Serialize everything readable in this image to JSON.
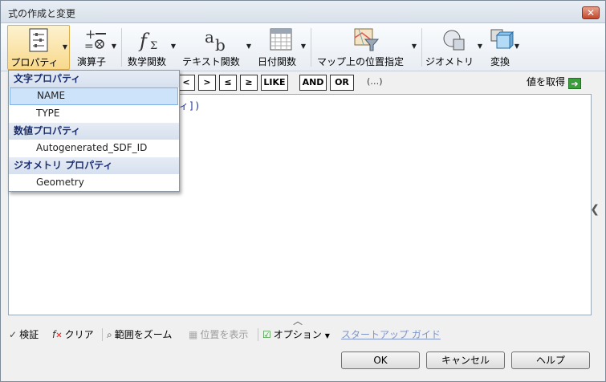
{
  "window": {
    "title": "式の作成と変更",
    "close": "✕"
  },
  "ribbon": {
    "properties": "プロパティ",
    "operators": "演算子",
    "math": "数学関数",
    "text": "テキスト関数",
    "date": "日付関数",
    "location": "マップ上の位置指定",
    "geometry": "ジオメトリ",
    "transform": "変換"
  },
  "operators_row": {
    "buttons": [
      "<",
      ">",
      "≤",
      "≥",
      "LIKE",
      "AND",
      "OR"
    ],
    "more": "(…)",
    "get_value": "値を取得",
    "get_value_icon": "➔"
  },
  "editor": {
    "visible_text": "ィ])"
  },
  "dropdown": {
    "groups": [
      {
        "header": "文字プロパティ",
        "items": [
          "NAME",
          "TYPE"
        ]
      },
      {
        "header": "数値プロパティ",
        "items": [
          "Autogenerated_SDF_ID"
        ]
      },
      {
        "header": "ジオメトリ プロパティ",
        "items": [
          "Geometry"
        ]
      }
    ],
    "selected": "NAME"
  },
  "bottom_tools": {
    "validate": "検証",
    "clear": "クリア",
    "zoom": "範囲をズーム",
    "show_location": "位置を表示",
    "options": "オプション",
    "startup_guide": "スタートアップ ガイド"
  },
  "buttons": {
    "ok": "OK",
    "cancel": "キャンセル",
    "help": "ヘルプ"
  },
  "colors": {
    "accent": "#1c2f6e",
    "selected_bg": "#cde3f9",
    "green_arrow": "#3a9e3a"
  }
}
